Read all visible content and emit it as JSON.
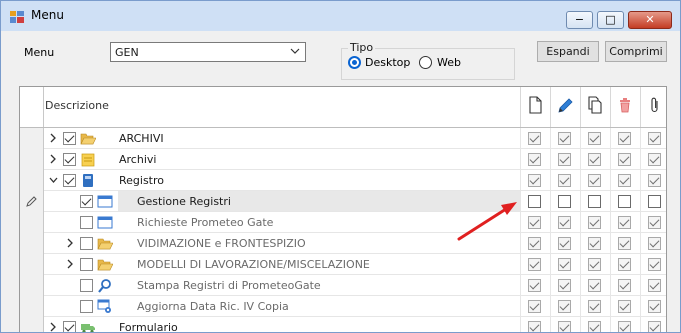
{
  "window": {
    "title": "Menu",
    "minimize_glyph": "−",
    "maximize_glyph": "□",
    "close_glyph": "✕"
  },
  "filters": {
    "menu_label": "Menu",
    "menu_value": "GEN",
    "tipo_label": "Tipo",
    "radio_desktop": "Desktop",
    "radio_web": "Web",
    "selected_tipo": "Desktop"
  },
  "buttons": {
    "expand": "Espandi",
    "collapse": "Comprimi"
  },
  "grid": {
    "header_description": "Descrizione",
    "column_icons": [
      "new-document-icon",
      "edit-pencil-icon",
      "copy-icon",
      "delete-trash-icon",
      "attachment-paperclip-icon"
    ],
    "rows": [
      {
        "label": "ARCHIVI",
        "level": 0,
        "expander": "collapsed",
        "tree_checked": true,
        "icon": "folder-open-icon",
        "perms": [
          true,
          true,
          true,
          true,
          true
        ],
        "style": "dark"
      },
      {
        "label": "Archivi",
        "level": 0,
        "expander": "collapsed",
        "tree_checked": true,
        "icon": "notes-icon",
        "perms": [
          true,
          true,
          true,
          true,
          true
        ],
        "style": "dark"
      },
      {
        "label": "Registro",
        "level": 0,
        "expander": "expanded",
        "tree_checked": true,
        "icon": "book-icon",
        "perms": [
          true,
          true,
          true,
          true,
          true
        ],
        "style": "dark"
      },
      {
        "label": "Gestione Registri",
        "level": 1,
        "expander": "none",
        "tree_checked": true,
        "icon": "window-icon",
        "perms": [
          false,
          false,
          false,
          false,
          false
        ],
        "style": "dark",
        "selected": true,
        "editing": true
      },
      {
        "label": "Richieste Prometeo Gate",
        "level": 1,
        "expander": "none",
        "tree_checked": false,
        "icon": "window-icon",
        "perms": [
          true,
          true,
          true,
          true,
          true
        ],
        "style": "grey"
      },
      {
        "label": "VIDIMAZIONE e FRONTESPIZIO",
        "level": 1,
        "expander": "collapsed",
        "tree_checked": false,
        "icon": "folder-open-icon",
        "perms": [
          true,
          true,
          true,
          true,
          true
        ],
        "style": "grey"
      },
      {
        "label": "MODELLI DI LAVORAZIONE/MISCELAZIONE",
        "level": 1,
        "expander": "collapsed",
        "tree_checked": false,
        "icon": "folder-open-icon",
        "perms": [
          true,
          true,
          true,
          true,
          true
        ],
        "style": "grey"
      },
      {
        "label": "Stampa Registri di PrometeoGate",
        "level": 1,
        "expander": "none",
        "tree_checked": false,
        "icon": "search-magnifier-icon",
        "perms": [
          true,
          true,
          true,
          true,
          true
        ],
        "style": "grey"
      },
      {
        "label": "Aggiorna Data Ric. IV Copia",
        "level": 1,
        "expander": "none",
        "tree_checked": false,
        "icon": "window-gear-icon",
        "perms": [
          true,
          true,
          true,
          true,
          true
        ],
        "style": "grey"
      },
      {
        "label": "Formulario",
        "level": 0,
        "expander": "collapsed",
        "tree_checked": true,
        "icon": "truck-icon",
        "perms": [
          true,
          true,
          true,
          true,
          true
        ],
        "style": "dark"
      }
    ]
  },
  "annotation": {
    "arrow_color": "#e02020"
  }
}
